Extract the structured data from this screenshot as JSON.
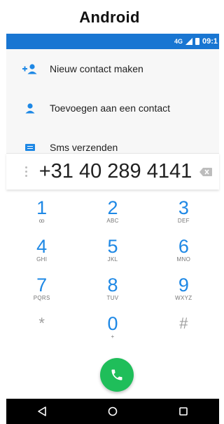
{
  "caption": "Android",
  "status_bar": {
    "network": "4G",
    "time": "09:1"
  },
  "actions": [
    {
      "label": "Nieuw contact maken",
      "icon": "add-contact-icon"
    },
    {
      "label": "Toevoegen aan een contact",
      "icon": "person-icon"
    },
    {
      "label": "Sms verzenden",
      "icon": "sms-icon"
    }
  ],
  "dialer": {
    "number": "+31 40 289 4141"
  },
  "keys": [
    {
      "digit": "1",
      "letters": "ꝏ"
    },
    {
      "digit": "2",
      "letters": "ABC"
    },
    {
      "digit": "3",
      "letters": "DEF"
    },
    {
      "digit": "4",
      "letters": "GHI"
    },
    {
      "digit": "5",
      "letters": "JKL"
    },
    {
      "digit": "6",
      "letters": "MNO"
    },
    {
      "digit": "7",
      "letters": "PQRS"
    },
    {
      "digit": "8",
      "letters": "TUV"
    },
    {
      "digit": "9",
      "letters": "WXYZ"
    },
    {
      "digit": "*",
      "letters": ""
    },
    {
      "digit": "0",
      "letters": "+"
    },
    {
      "digit": "#",
      "letters": ""
    }
  ],
  "colors": {
    "status_bar": "#1976d2",
    "accent": "#1e88e5",
    "call_button": "#1fbe5a"
  }
}
